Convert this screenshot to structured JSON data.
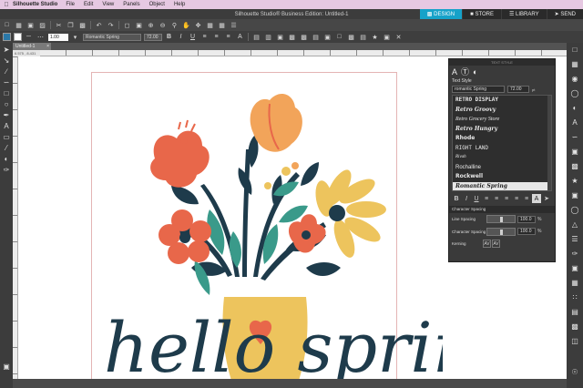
{
  "menubar": {
    "app": "Silhouette Studio",
    "items": [
      "File",
      "Edit",
      "View",
      "Panels",
      "Object",
      "Help"
    ]
  },
  "window": {
    "title": "Silhouette Studio® Business Edition: Untitled-1",
    "tabs": [
      {
        "label": "DESIGN",
        "icon": "design-icon",
        "active": true
      },
      {
        "label": "STORE",
        "icon": "store-icon",
        "active": false
      },
      {
        "label": "LIBRARY",
        "icon": "library-icon",
        "active": false
      },
      {
        "label": "SEND",
        "icon": "send-icon",
        "active": false
      }
    ]
  },
  "toolbar2": {
    "line_width": "1.00",
    "font": "Romantic Spring",
    "size": "72.00"
  },
  "document": {
    "tab": "Untitled-1",
    "coords": "6.575 , 8.431"
  },
  "canvas": {
    "artwork_text": "hello spring",
    "colors": {
      "ink": "#1e3b4b",
      "coral": "#e8674a",
      "orange": "#f2a45a",
      "yellow": "#edc45d",
      "teal": "#3a9a8a",
      "pink": "#e8674a"
    }
  },
  "text_style_panel": {
    "header": "TEXT STYLE",
    "label": "Text Style",
    "font": "romantic Spring",
    "size": "72.00",
    "unit": "pt",
    "fonts": [
      "RETRO DISPLAY",
      "Retro Groovy",
      "Retro Grocery Store",
      "Retro Hungry",
      "Rhode",
      "RIGHT LAND",
      "Rivah",
      "Rochalline",
      "Rockwell",
      "Romantic Spring"
    ],
    "selected_font": "Romantic Spring",
    "section": "Character Spacing",
    "line_spacing": {
      "label": "Line Spacing",
      "value": "100.0",
      "unit": "%"
    },
    "char_spacing": {
      "label": "Character Spacing",
      "value": "100.0",
      "unit": "%"
    },
    "kerning_label": "Kerning"
  }
}
